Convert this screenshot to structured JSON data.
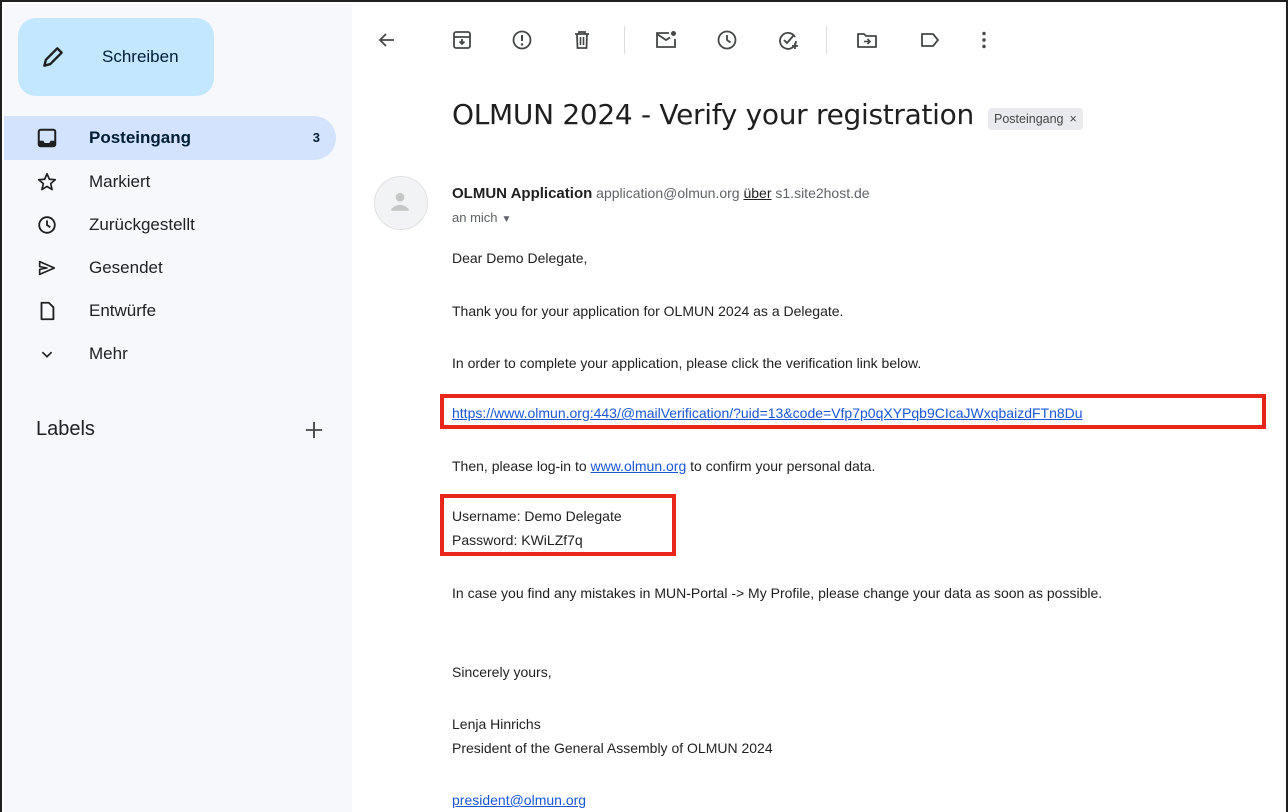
{
  "sidebar": {
    "compose_label": "Schreiben",
    "items": [
      {
        "label": "Posteingang",
        "count": "3",
        "icon": "inbox-icon"
      },
      {
        "label": "Markiert",
        "icon": "star-icon"
      },
      {
        "label": "Zurückgestellt",
        "icon": "clock-icon"
      },
      {
        "label": "Gesendet",
        "icon": "send-icon"
      },
      {
        "label": "Entwürfe",
        "icon": "draft-icon"
      },
      {
        "label": "Mehr",
        "icon": "chevron-down-icon"
      }
    ],
    "labels_heading": "Labels"
  },
  "toolbar": {
    "icons": [
      "back-arrow-icon",
      "archive-icon",
      "report-spam-icon",
      "delete-icon",
      "mark-unread-icon",
      "snooze-icon",
      "add-task-icon",
      "move-to-icon",
      "label-icon",
      "more-vert-icon"
    ]
  },
  "message": {
    "subject": "OLMUN 2024 - Verify your registration",
    "chip": "Posteingang",
    "chip_close": "×",
    "sender_name": "OLMUN Application",
    "sender_email": "application@olmun.org",
    "via_label": "über",
    "via_host": "s1.site2host.de",
    "to_me": "an mich",
    "greeting": "Dear Demo Delegate,",
    "line1": "Thank you for your application for OLMUN 2024 as a Delegate.",
    "line2": "In order to complete your application, please click the verification link below.",
    "verify_link": "https://www.olmun.org:443/@mailVerification/?uid=13&code=Vfp7p0qXYPqb9CIcaJWxqbaizdFTn8Du",
    "line3_pre": "Then, please log-in to",
    "site_link": "www.olmun.org",
    "line3_post": "to confirm your personal data.",
    "username": "Username: Demo Delegate",
    "password": "Password: KWiLZf7q",
    "line4": "In case you find any mistakes in MUN-Portal -> My Profile, please change your data as soon as possible.",
    "closing": "Sincerely yours,",
    "sig_name": "Lenja Hinrichs",
    "sig_title": "President of the General Assembly of OLMUN 2024",
    "sig_email": "president@olmun.org"
  },
  "colors": {
    "compose_bg": "#c2e7ff",
    "active_nav_bg": "#d3e3fd",
    "sidebar_bg": "#f6f8fc",
    "link": "#1a57d6",
    "highlight": "#e8261a"
  }
}
